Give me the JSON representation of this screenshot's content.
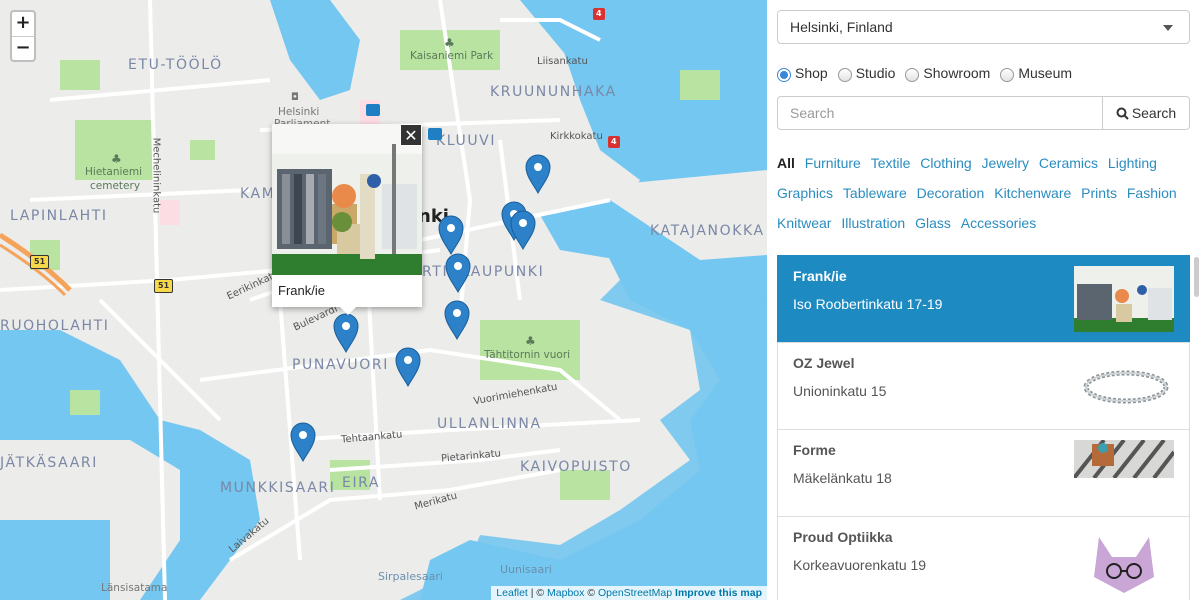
{
  "map": {
    "zoom_in": "+",
    "zoom_out": "−",
    "districts": {
      "etu_toolo": "ETU-TÖÖLÖ",
      "kruununhaka": "KRUUNUNHAKA",
      "kluuvi": "KLUUVI",
      "lapinlahti": "LAPINLAHTI",
      "katajanokka": "KATAJANOKKA",
      "kaartinkaupunki": "RTINKAUPUNKI",
      "kamppi": "KAM",
      "ruoholahti": "RUOHOLAHTI",
      "punavuori": "PUNAVUORI",
      "ullanlinna": "ULLANLINNA",
      "kaivopuisto": "KAIVOPUISTO",
      "jatkasaari": "JÄTKÄSAARI",
      "munkkisaari": "MUNKKISAARI",
      "eira": "EIRA",
      "helsinki_city": "nki"
    },
    "streets": {
      "liisankatu": "Liisankatu",
      "kirkkokatu": "Kirkkokatu",
      "mechelininkatu": "Mechelininkatu",
      "eerikinkatu": "Eerikinkatu",
      "bulevardi": "Bulevardi",
      "vuorimiehenkatu": "Vuorimiehenkatu",
      "tehtaankatu": "Tehtaankatu",
      "pietarinkatu": "Pietarinkatu",
      "merikatu": "Merikatu",
      "laivakatu": "Laivakatu"
    },
    "pois": {
      "kaisaniemi": "Kaisaniemi Park",
      "hietaniemi_1": "Hietaniemi",
      "hietaniemi_2": "cemetery",
      "parliament_1": "Helsinki",
      "parliament_2": "Parliament",
      "tahtitorni": "Tähtitornin vuori",
      "lansisatama": "Länsisatama",
      "sirpalesaari": "Sirpalesaari",
      "uunisaari": "Uunisaari"
    },
    "shields": {
      "r4a": "4",
      "r4b": "4",
      "r51a": "51",
      "r51b": "51"
    },
    "popup": {
      "title": "Frank/ie",
      "close": "✕"
    },
    "attribution": {
      "leaflet": "Leaflet",
      "sep1": " | © ",
      "mapbox": "Mapbox",
      "sep2": " © ",
      "osm": "OpenStreetMap",
      "improve": "Improve this map"
    },
    "marker_color": "#2c81c9"
  },
  "panel": {
    "city_select": "Helsinki, Finland",
    "types": [
      {
        "label": "Shop",
        "selected": true
      },
      {
        "label": "Studio",
        "selected": false
      },
      {
        "label": "Showroom",
        "selected": false
      },
      {
        "label": "Museum",
        "selected": false
      }
    ],
    "search_placeholder": "Search",
    "search_button": "Search",
    "categories": [
      "All",
      "Furniture",
      "Textile",
      "Clothing",
      "Jewelry",
      "Ceramics",
      "Lighting",
      "Graphics",
      "Tableware",
      "Decoration",
      "Kitchenware",
      "Prints",
      "Fashion",
      "Knitwear",
      "Illustration",
      "Glass",
      "Accessories"
    ],
    "active_category": "All",
    "places": [
      {
        "name": "Frank/ie",
        "address": "Iso Roobertinkatu 17-19",
        "active": true
      },
      {
        "name": "OZ Jewel",
        "address": "Unioninkatu 15",
        "active": false
      },
      {
        "name": "Forme",
        "address": "Mäkelänkatu 18",
        "active": false
      },
      {
        "name": "Proud Optiikka",
        "address": "Korkeavuorenkatu 19",
        "active": false
      }
    ],
    "active_color": "#1d8bc2"
  }
}
